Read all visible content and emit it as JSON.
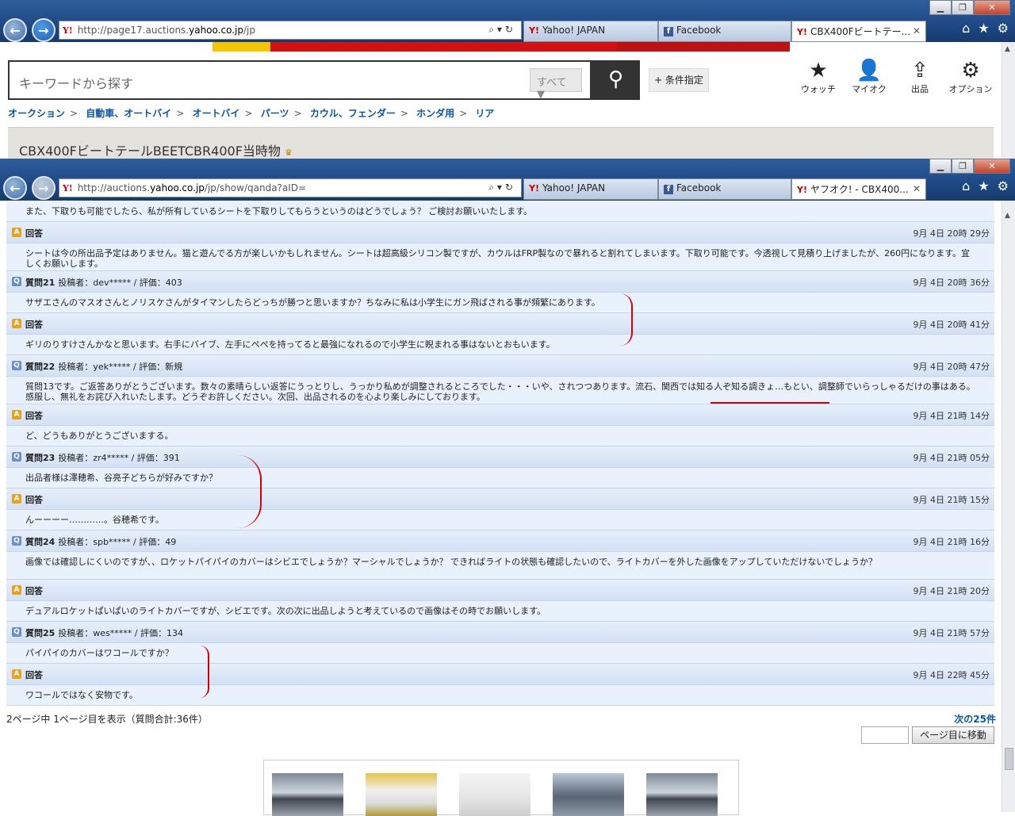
{
  "window1": {
    "url_prefix": "http://page17.auctions.",
    "url_domain": "yahoo.co.jp",
    "url_suffix": "/jp",
    "tabs": [
      {
        "label": "Yahoo! JAPAN",
        "logo": "Y!"
      },
      {
        "label": "Facebook",
        "logo": "f"
      },
      {
        "label": "CBX400Fビートテー...",
        "logo": "Y!"
      }
    ],
    "search_placeholder": "キーワードから探す",
    "search_category": "すべて ▼",
    "conditions_button": "+ 条件指定",
    "icon_nav": [
      {
        "label": "ウォッチ",
        "icon": "star-icon"
      },
      {
        "label": "マイオク",
        "icon": "user-icon"
      },
      {
        "label": "出品",
        "icon": "upload-icon"
      },
      {
        "label": "オプション",
        "icon": "gear-icon"
      }
    ],
    "breadcrumb": [
      "オークション",
      "自動車、オートバイ",
      "オートバイ",
      "パーツ",
      "カウル、フェンダー",
      "ホンダ用",
      "リア"
    ],
    "item_title": "CBX400FビートテールBEETCBR400F当時物"
  },
  "window2": {
    "url_prefix": "http://auctions.",
    "url_domain": "yahoo.co.jp",
    "url_suffix": "/jp/show/qanda?aID=",
    "tabs": [
      {
        "label": "Yahoo! JAPAN",
        "logo": "Y!"
      },
      {
        "label": "Facebook",
        "logo": "f"
      },
      {
        "label": "ヤフオク! - CBX400...",
        "logo": "Y!"
      }
    ],
    "qa_rows": [
      {
        "kind": "body",
        "text": "また、下取りも可能でしたら、私が所有しているシートを下取りしてもらうというのはどうでしょう？ ご検討お願いいたします。"
      },
      {
        "kind": "answer",
        "label": "回答",
        "date": "9月 4日 20時 29分"
      },
      {
        "kind": "body",
        "text": "シートは今の所出品予定はありません。猫と遊んでる方が楽しいかもしれません。シートは超高級シリコン製ですが、カウルはFRP製なので暴れると割れてしまいます。下取り可能です。今透視して見積り上げましたが、260円になります。宜しくお願いします。"
      },
      {
        "kind": "question",
        "label": "質問21",
        "meta": "投稿者：dev***** / 評価：403",
        "date": "9月 4日 20時 36分"
      },
      {
        "kind": "body",
        "text": "サザエさんのマスオさんとノリスケさんがタイマンしたらどっちが勝つと思いますか？ちなみに私は小学生にガン飛ばされる事が頻繁にあります。"
      },
      {
        "kind": "answer",
        "label": "回答",
        "date": "9月 4日 20時 41分"
      },
      {
        "kind": "body",
        "text": "ギリのりすけさんかなと思います。右手にバイブ、左手にペペを持ってると最強になれるので小学生に睨まれる事はないとおもいます。"
      },
      {
        "kind": "question",
        "label": "質問22",
        "meta": "投稿者：yek***** / 評価：新規",
        "date": "9月 4日 20時 47分"
      },
      {
        "kind": "body",
        "text": "質問13です。ご返答ありがとうございます。数々の素晴らしい返答にうっとりし、うっかり私めが調整されるところでした・・・いや、されつつあります。流石、関西では知る人ぞ知る調きょ…もとい、調整師でいらっしゃるだけの事はある。感服し、無礼をお詫び入れいたします。どうぞお許しください。次回、出品されるのを心より楽しみにしております。"
      },
      {
        "kind": "answer",
        "label": "回答",
        "date": "9月 4日 21時 14分"
      },
      {
        "kind": "body",
        "text": "ど、どうもありがとうございまする。"
      },
      {
        "kind": "question",
        "label": "質問23",
        "meta": "投稿者：zr4***** / 評価：391",
        "date": "9月 4日 21時 05分"
      },
      {
        "kind": "body",
        "text": "出品者様は澤穂希、谷亮子どちらが好みですか？"
      },
      {
        "kind": "answer",
        "label": "回答",
        "date": "9月 4日 21時 15分"
      },
      {
        "kind": "body",
        "text": "んーーーー…………。谷穂希です。"
      },
      {
        "kind": "question",
        "label": "質問24",
        "meta": "投稿者：spb***** / 評価：49",
        "date": "9月 4日 21時 16分"
      },
      {
        "kind": "body",
        "text": "画像では確認しにくいのですが、、ロケットパイパイのカバーはシビエでしょうか？マーシャルでしょうか？ できればライトの状態も確認したいので、ライトカバーを外した画像をアップしていただけないでしょうか？"
      },
      {
        "kind": "answer",
        "label": "回答",
        "date": "9月 4日 21時 20分"
      },
      {
        "kind": "body",
        "text": "デュアルロケットぱいぱいのライトカバーですが、シビエです。次の次に出品しようと考えているので画像はその時でお願いします。"
      },
      {
        "kind": "question",
        "label": "質問25",
        "meta": "投稿者：wes***** / 評価：134",
        "date": "9月 4日 21時 57分"
      },
      {
        "kind": "body",
        "text": "パイパイのカバーはワコールですか？"
      },
      {
        "kind": "answer",
        "label": "回答",
        "date": "9月 4日 22時 45分"
      },
      {
        "kind": "body",
        "text": "ワコールではなく安物です。"
      }
    ],
    "pager_text": "2ページ中 1ページ目を表示（質問合計:36件）",
    "next_link": "次の25件",
    "page_button": "ページ目に移動"
  }
}
